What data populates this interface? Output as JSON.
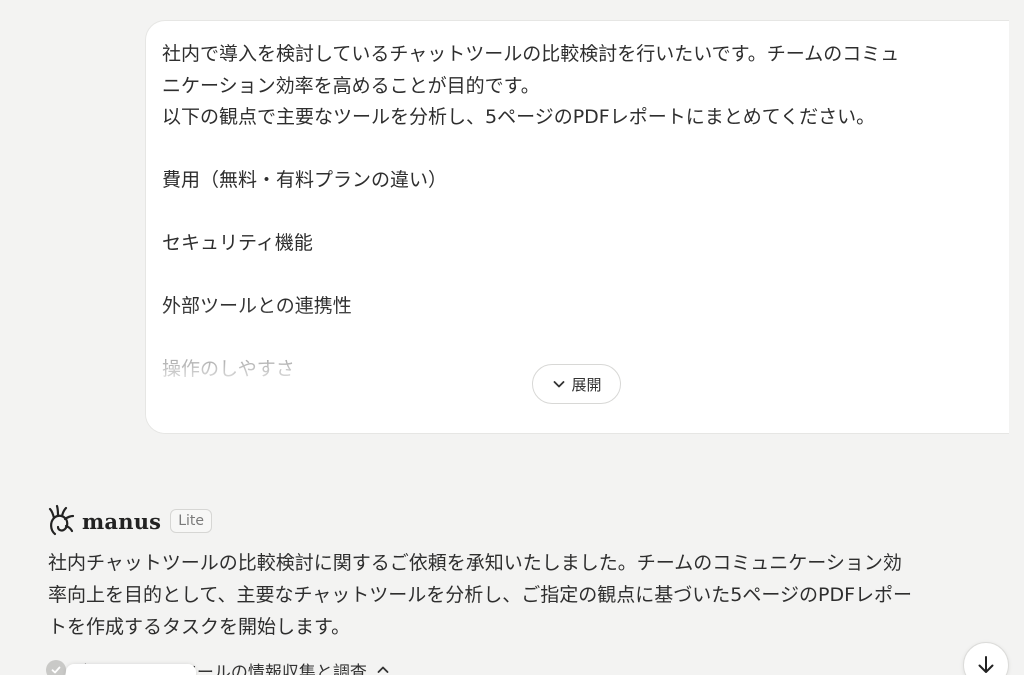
{
  "user_message": {
    "lines": [
      "社内で導入を検討しているチャットツールの比較検討を行いたいです。チームのコミュ",
      "ニケーション効率を高めることが目的です。",
      "以下の観点で主要なツールを分析し、5ページのPDFレポートにまとめてください。",
      "費用（無料・有料プランの違い）",
      "セキュリティ機能",
      "外部ツールとの連携性",
      "操作のしやすさ"
    ],
    "expand_label": "展開",
    "expand_icon": "chevron-down-icon"
  },
  "assistant": {
    "name": "manus",
    "plan_badge": "Lite",
    "logo_icon": "manus-logo-icon",
    "message_lines": [
      "社内チャットツールの比較検討に関するご依頼を承知いたしました。チームのコミュニケーション効",
      "率向上を目的として、主要なチャットツールを分析し、ご指定の観点に基づいた5ページのPDFレポー",
      "トを作成するタスクを開始します。"
    ],
    "task": {
      "label": "主要チャットツールの情報収集と調査",
      "status_icon": "check-circle-icon",
      "toggle_icon": "chevron-up-icon"
    }
  },
  "scroll_button": {
    "icon": "arrow-down-icon"
  },
  "colors": {
    "background": "#f3f3f2",
    "card": "#ffffff",
    "text": "#2e2e2e",
    "muted": "#9a9a9a"
  }
}
